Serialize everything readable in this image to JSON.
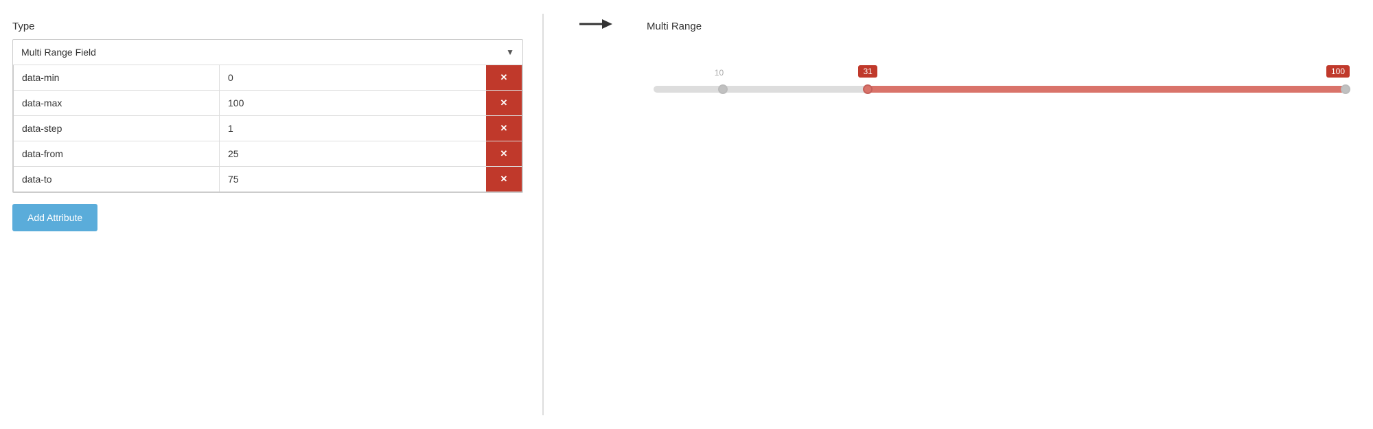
{
  "left": {
    "type_label": "Type",
    "select_value": "Multi Range Field",
    "dropdown_arrow": "▼",
    "attributes": [
      {
        "name": "data-min",
        "value": "0"
      },
      {
        "name": "data-max",
        "value": "100"
      },
      {
        "name": "data-step",
        "value": "1"
      },
      {
        "name": "data-from",
        "value": "25"
      },
      {
        "name": "data-to",
        "value": "75"
      }
    ],
    "add_button_label": "Add Attribute",
    "delete_icon": "✕"
  },
  "right": {
    "preview_title": "Multi Range",
    "slider": {
      "min": 0,
      "max": 100,
      "value_left_label": "10",
      "handle_from": 31,
      "handle_to": 100,
      "tooltip_from": "31",
      "tooltip_to": "100"
    }
  }
}
